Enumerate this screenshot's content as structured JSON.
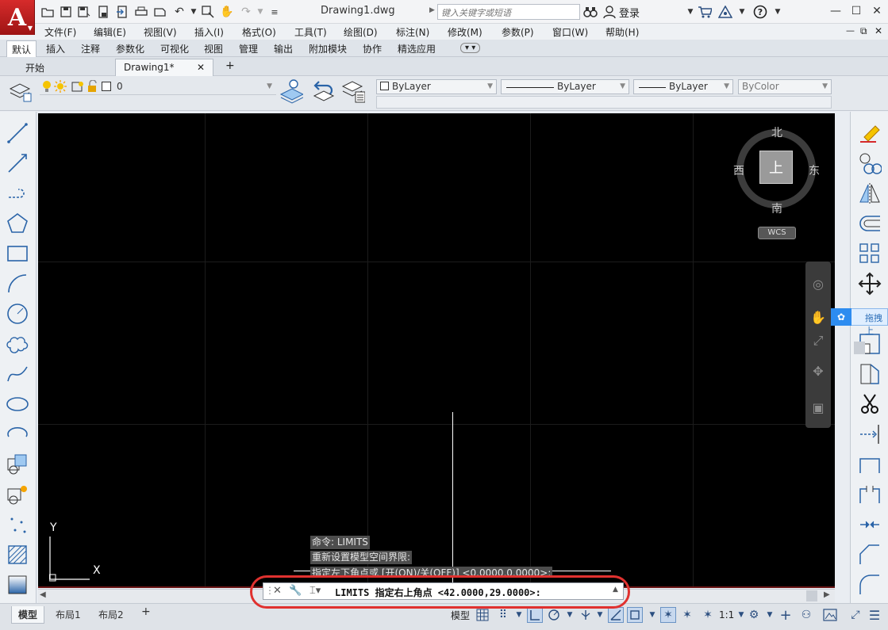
{
  "title_bar": {
    "logo_letter": "A",
    "doc_title": "Drawing1.dwg",
    "search_placeholder": "键入关键字或短语",
    "login": "登录"
  },
  "menu": [
    "文件(F)",
    "编辑(E)",
    "视图(V)",
    "插入(I)",
    "格式(O)",
    "工具(T)",
    "绘图(D)",
    "标注(N)",
    "修改(M)",
    "参数(P)",
    "窗口(W)",
    "帮助(H)"
  ],
  "ribbon_tabs": [
    "默认",
    "插入",
    "注释",
    "参数化",
    "可视化",
    "视图",
    "管理",
    "输出",
    "附加模块",
    "协作",
    "精选应用"
  ],
  "file_tabs": {
    "start": "开始",
    "drawing": "Drawing1*",
    "new": "+"
  },
  "properties": {
    "layer_value": "0",
    "color": "ByLayer",
    "linetype": "ByLayer",
    "lineweight": "ByLayer",
    "plotstyle": "ByColor"
  },
  "viewcube": {
    "north": "北",
    "south": "南",
    "east": "东",
    "west": "西",
    "top": "上",
    "wcs": "WCS"
  },
  "ucs": {
    "x_label": "X",
    "y_label": "Y"
  },
  "command_history": [
    "命令: LIMITS",
    "重新设置模型空间界限:",
    "指定左下角点或 [开(ON)/关(OFF)] <0.0000,0.0000>:"
  ],
  "command_line": {
    "current": "LIMITS 指定右上角点 <42.0000,29.0000>:"
  },
  "layout_tabs": [
    "模型",
    "布局1",
    "布局2"
  ],
  "status_bar": {
    "model_label": "模型",
    "scale": "1:1"
  },
  "baidu_overlay": {
    "label": "拖拽上"
  }
}
